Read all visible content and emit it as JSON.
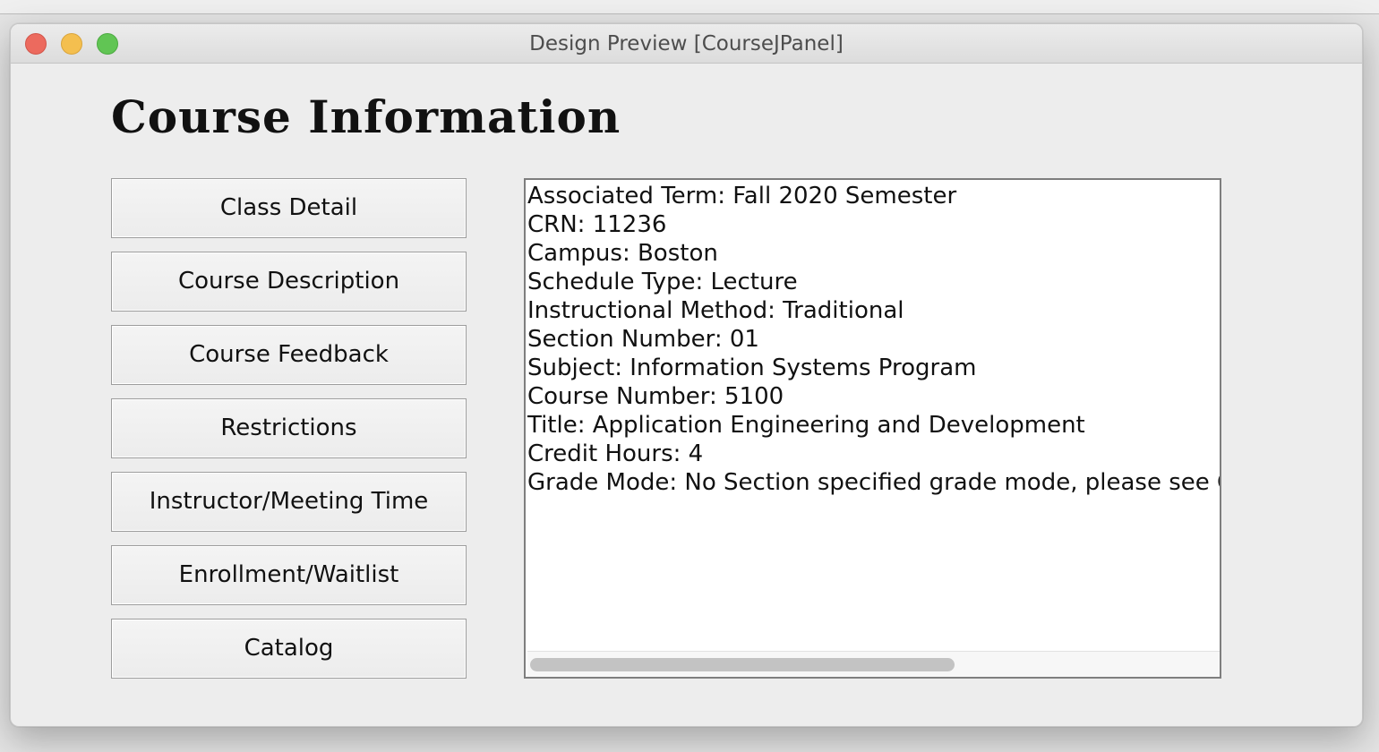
{
  "window": {
    "title": "Design Preview [CourseJPanel]",
    "controls": {
      "close_color": "#ec6a5e",
      "minimize_color": "#f4bf4f",
      "maximize_color": "#61c554"
    }
  },
  "panel": {
    "heading": "Course Information",
    "buttons": [
      {
        "label": "Class Detail"
      },
      {
        "label": "Course Description"
      },
      {
        "label": "Course Feedback"
      },
      {
        "label": "Restrictions"
      },
      {
        "label": "Instructor/Meeting Time"
      },
      {
        "label": "Enrollment/Waitlist"
      },
      {
        "label": "Catalog"
      }
    ],
    "details": [
      "Associated Term: Fall 2020 Semester",
      "CRN: 11236",
      "Campus: Boston",
      "Schedule Type: Lecture",
      "Instructional Method: Traditional",
      "Section Number: 01",
      "Subject: Information Systems Program",
      "Course Number: 5100",
      "Title: Application Engineering and Development",
      "Credit Hours: 4",
      "Grade Mode: No Section specified grade mode, please see Cat"
    ]
  }
}
